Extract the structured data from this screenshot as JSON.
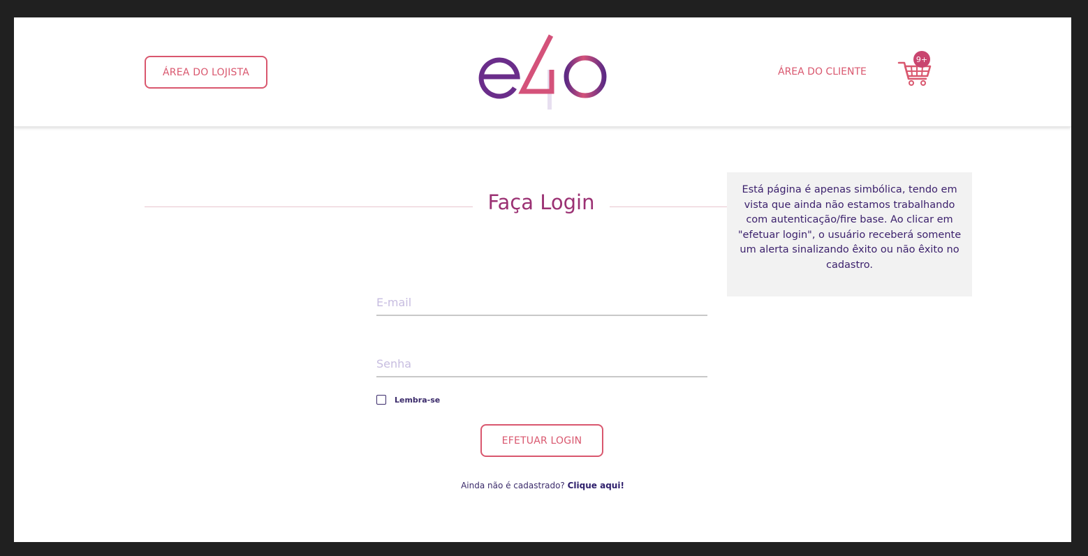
{
  "header": {
    "lojista_button": "ÁREA DO LOJISTA",
    "cliente_link": "ÁREA DO CLIENTE",
    "cart_badge": "9+",
    "logo_icon": "e4o-logo"
  },
  "colors": {
    "accent": "#d9576e",
    "title": "#9b3173",
    "text_dark": "#3a2a6a",
    "page_bg": "#202020"
  },
  "main": {
    "title": "Faça Login",
    "notice": "Está página é apenas simbólica, tendo em vista que ainda não estamos trabalhando com autenticação/fire base. Ao clicar em \"efetuar login\", o usuário receberá somente um alerta  sinalizando êxito ou não êxito no cadastro.",
    "email_placeholder": "E-mail",
    "senha_placeholder": "Senha",
    "remember_label": "Lembra-se",
    "login_button": "EFETUAR LOGIN",
    "signup_text": "Ainda não é cadastrado? ",
    "signup_link": "Clique aqui!"
  }
}
